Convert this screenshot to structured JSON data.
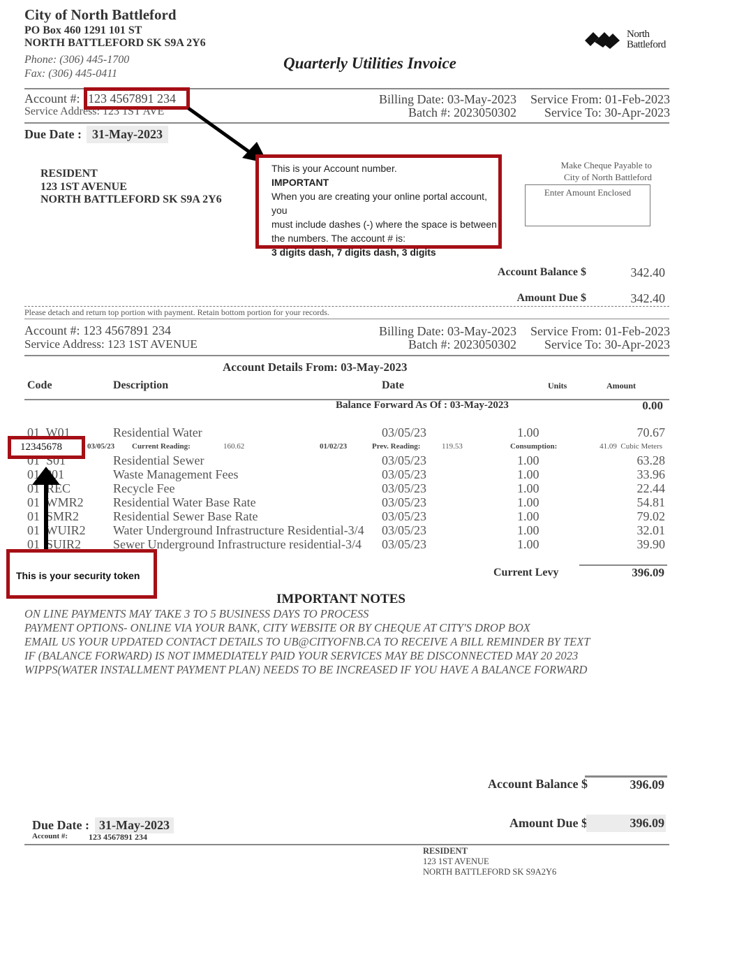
{
  "header": {
    "org_name": "City of North Battleford",
    "address_line1": "PO Box 460 1291 101 ST",
    "address_line2": "NORTH BATTLEFORD SK  S9A 2Y6",
    "phone": "Phone: (306) 445-1700",
    "fax": "Fax: (306) 445-0411",
    "doc_title": "Quarterly Utilities Invoice",
    "logo_line1": "North",
    "logo_line2": "Battleford"
  },
  "top_stub": {
    "account_label": "Account #:",
    "account_number": "123 4567891 234",
    "service_address": "Service Address: 123 1ST AVE",
    "billing_date": "Billing Date: 03-May-2023",
    "batch": "Batch #: 2023050302",
    "service_from": "Service From: 01-Feb-2023",
    "service_to": "Service To: 30-Apr-2023",
    "due_date_label": "Due Date :",
    "due_date": "31-May-2023",
    "recipient": [
      "RESIDENT",
      "123 1ST AVENUE",
      "NORTH BATTLEFORD SK  S9A 2Y6"
    ],
    "cheque_line1": "Make Cheque Payable to",
    "cheque_line2": "City of North Battleford",
    "amount_enclosed_label": "Enter Amount Enclosed",
    "account_balance_label": "Account Balance $",
    "account_balance": "342.40",
    "amount_due_label": "Amount Due $",
    "amount_due": "342.40",
    "detach_note": "Please detach and return top portion with payment. Retain bottom portion for your records."
  },
  "annotations": {
    "account_callout": {
      "line1": "This is your Account number.",
      "line2": "IMPORTANT",
      "line3": "When you are creating your online portal account, you",
      "line4": "must include dashes (-) where the space is between",
      "line5": "the numbers. The account # is:",
      "line6": "3 digits dash, 7 digits dash, 3 digits"
    },
    "token_value": "12345678",
    "token_callout": "This is your security token",
    "accent_color": "#a50f15"
  },
  "bottom": {
    "account": "Account #:  123 4567891 234",
    "service_address": "Service Address: 123 1ST AVENUE",
    "billing_date": "Billing Date: 03-May-2023",
    "batch": "Batch #: 2023050302",
    "service_from": "Service From: 01-Feb-2023",
    "service_to": "Service To: 30-Apr-2023",
    "details_title": "Account Details From: 03-May-2023",
    "columns": {
      "code": "Code",
      "description": "Description",
      "date": "Date",
      "units": "Units",
      "amount": "Amount"
    },
    "balance_forward_label": "Balance Forward As Of : 03-May-2023",
    "balance_forward": "0.00",
    "rows": [
      {
        "code": "01  W01",
        "description": "Residential Water",
        "date": "03/05/23",
        "units": "1.00",
        "amount": "70.67"
      },
      {
        "code": "01  S01",
        "description": "Residential Sewer",
        "date": "03/05/23",
        "units": "1.00",
        "amount": "63.28"
      },
      {
        "code": "01  ?01",
        "description": "Waste Management Fees",
        "date": "03/05/23",
        "units": "1.00",
        "amount": "33.96"
      },
      {
        "code": "01  REC",
        "description": "Recycle Fee",
        "date": "03/05/23",
        "units": "1.00",
        "amount": "22.44"
      },
      {
        "code": "01  WMR2",
        "description": "Residential Water Base Rate",
        "date": "03/05/23",
        "units": "1.00",
        "amount": "54.81"
      },
      {
        "code": "01  SMR2",
        "description": "Residential Sewer Base Rate",
        "date": "03/05/23",
        "units": "1.00",
        "amount": "79.02"
      },
      {
        "code": "01  WUIR2",
        "description": "Water Underground Infrastructure Residential-3/4",
        "date": "03/05/23",
        "units": "1.00",
        "amount": "32.01"
      },
      {
        "code": "01  SUIR2",
        "description": "Sewer Underground Infrastructure residential-3/4",
        "date": "03/05/23",
        "units": "1.00",
        "amount": "39.90"
      }
    ],
    "meter": {
      "current_date": "03/05/23",
      "current_label": "Current Reading:",
      "current_value": "160.62",
      "prev_date": "01/02/23",
      "prev_label": "Prev. Reading:",
      "prev_value": "119.53",
      "consumption_label": "Consumption:",
      "consumption_value": "41.09  Cubic Meters"
    },
    "current_levy_label": "Current Levy",
    "current_levy": "396.09",
    "notes_title": "IMPORTANT NOTES",
    "notes": [
      "ON LINE PAYMENTS MAY TAKE 3 TO 5 BUSINESS DAYS TO PROCESS",
      "PAYMENT OPTIONS- ONLINE VIA YOUR BANK, CITY WEBSITE OR BY CHEQUE AT CITY'S DROP BOX",
      "EMAIL US YOUR UPDATED CONTACT DETAILS TO UB@CITYOFNB.CA TO RECEIVE A BILL REMINDER BY TEXT",
      "IF (BALANCE FORWARD)  IS NOT IMMEDIATELY PAID YOUR SERVICES MAY BE DISCONNECTED MAY 20 2023",
      "WIPPS(WATER INSTALLMENT PAYMENT PLAN) NEEDS TO BE INCREASED IF YOU HAVE A BALANCE FORWARD"
    ],
    "account_balance_label": "Account Balance $",
    "account_balance": "396.09",
    "amount_due_label": "Amount Due $",
    "amount_due": "396.09",
    "due_date_label": "Due Date :",
    "due_date": "31-May-2023",
    "small_account_label": "Account #:",
    "small_account_number": "123 4567891 234",
    "recipient": [
      "RESIDENT",
      "123 1ST AVENUE",
      "NORTH BATTLEFORD SK  S9A2Y6"
    ]
  }
}
